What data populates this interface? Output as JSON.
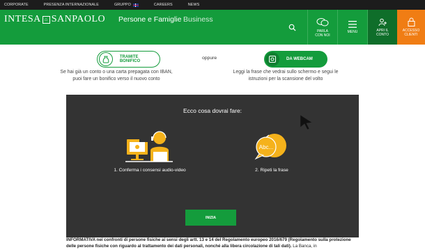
{
  "topbar": {
    "items": [
      "CORPORATE",
      "PRESENZA INTERNAZIONALE",
      "GRUPPO",
      "CAREERS",
      "NEWS"
    ]
  },
  "header": {
    "logo": "INTESA SANPAOLO",
    "nav_main": "Persone e Famiglie",
    "nav_business": "Business",
    "parla": [
      "PARLA",
      "CON NOI"
    ],
    "menu": "MENU",
    "apri": [
      "APRI IL",
      "CONTO"
    ],
    "accesso": [
      "ACCESSO",
      "CLIENTI"
    ],
    "accent": "#149c3c",
    "accesso_color": "#f07d14"
  },
  "options": {
    "bonifico_label": "TRAMITE BONIFICO",
    "oppure": "oppure",
    "webcam_label": "DA WEBCAM",
    "bonifico_desc": "Se hai già un conto o una carta prepagata con IBAN, puoi fare un bonifico verso il nuovo conto",
    "webcam_desc": "Leggi la frase che vedrai sullo schermo e segui le istruzioni per la scansione del volto"
  },
  "panel": {
    "title": "Ecco cosa dovrai fare:",
    "step1": "1. Conferma i consensi audio-video",
    "step2": "2. Ripeti la frase",
    "bubble_text": "Abc...",
    "start_button": "INIZIA"
  },
  "info": {
    "bold": "INFORMATIVA nei confronti di persone fisiche ai sensi degli artt. 13 e 14 del Regolamento europeo 2016/679 (Regolamento sulla protezione delle persone fisiche con riguardo al trattamento dei dati personali, nonché alla libera circolazione di tali dati).",
    "rest": " La Banca, in"
  }
}
